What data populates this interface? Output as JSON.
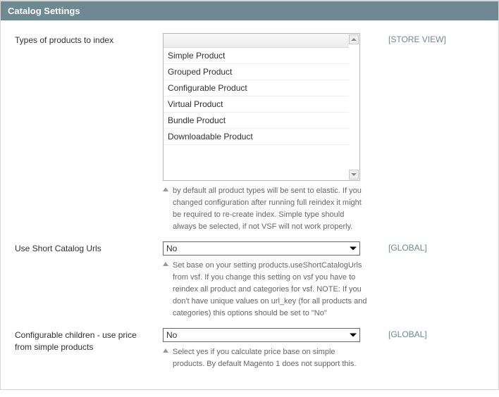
{
  "panel": {
    "title": "Catalog Settings"
  },
  "scopes": {
    "store_view": "[STORE VIEW]",
    "global": "[GLOBAL]"
  },
  "fields": {
    "types_to_index": {
      "label": "Types of products to index",
      "options": [
        "Simple Product",
        "Grouped Product",
        "Configurable Product",
        "Virtual Product",
        "Bundle Product",
        "Downloadable Product"
      ],
      "hint": "by default all product types will be sent to elastic. If you changed configuration after running full reindex it might be required to re-create index. Simple type should always be selected, if not VSF will not work properly."
    },
    "short_catalog_urls": {
      "label": "Use Short Catalog Urls",
      "value": "No",
      "hint": "Set base on your setting products.useShortCatalogUrls from vsf. If you change this setting on vsf you have to reindex all product and categories for vsf. NOTE: If you don't have unique values on url_key (for all products and categories) this options should be set to \"No\""
    },
    "configurable_children_price": {
      "label": "Configurable children - use price from simple products",
      "value": "No",
      "hint": "Select yes if you calculate price base on simple products. By default Magento 1 does not support this."
    }
  }
}
